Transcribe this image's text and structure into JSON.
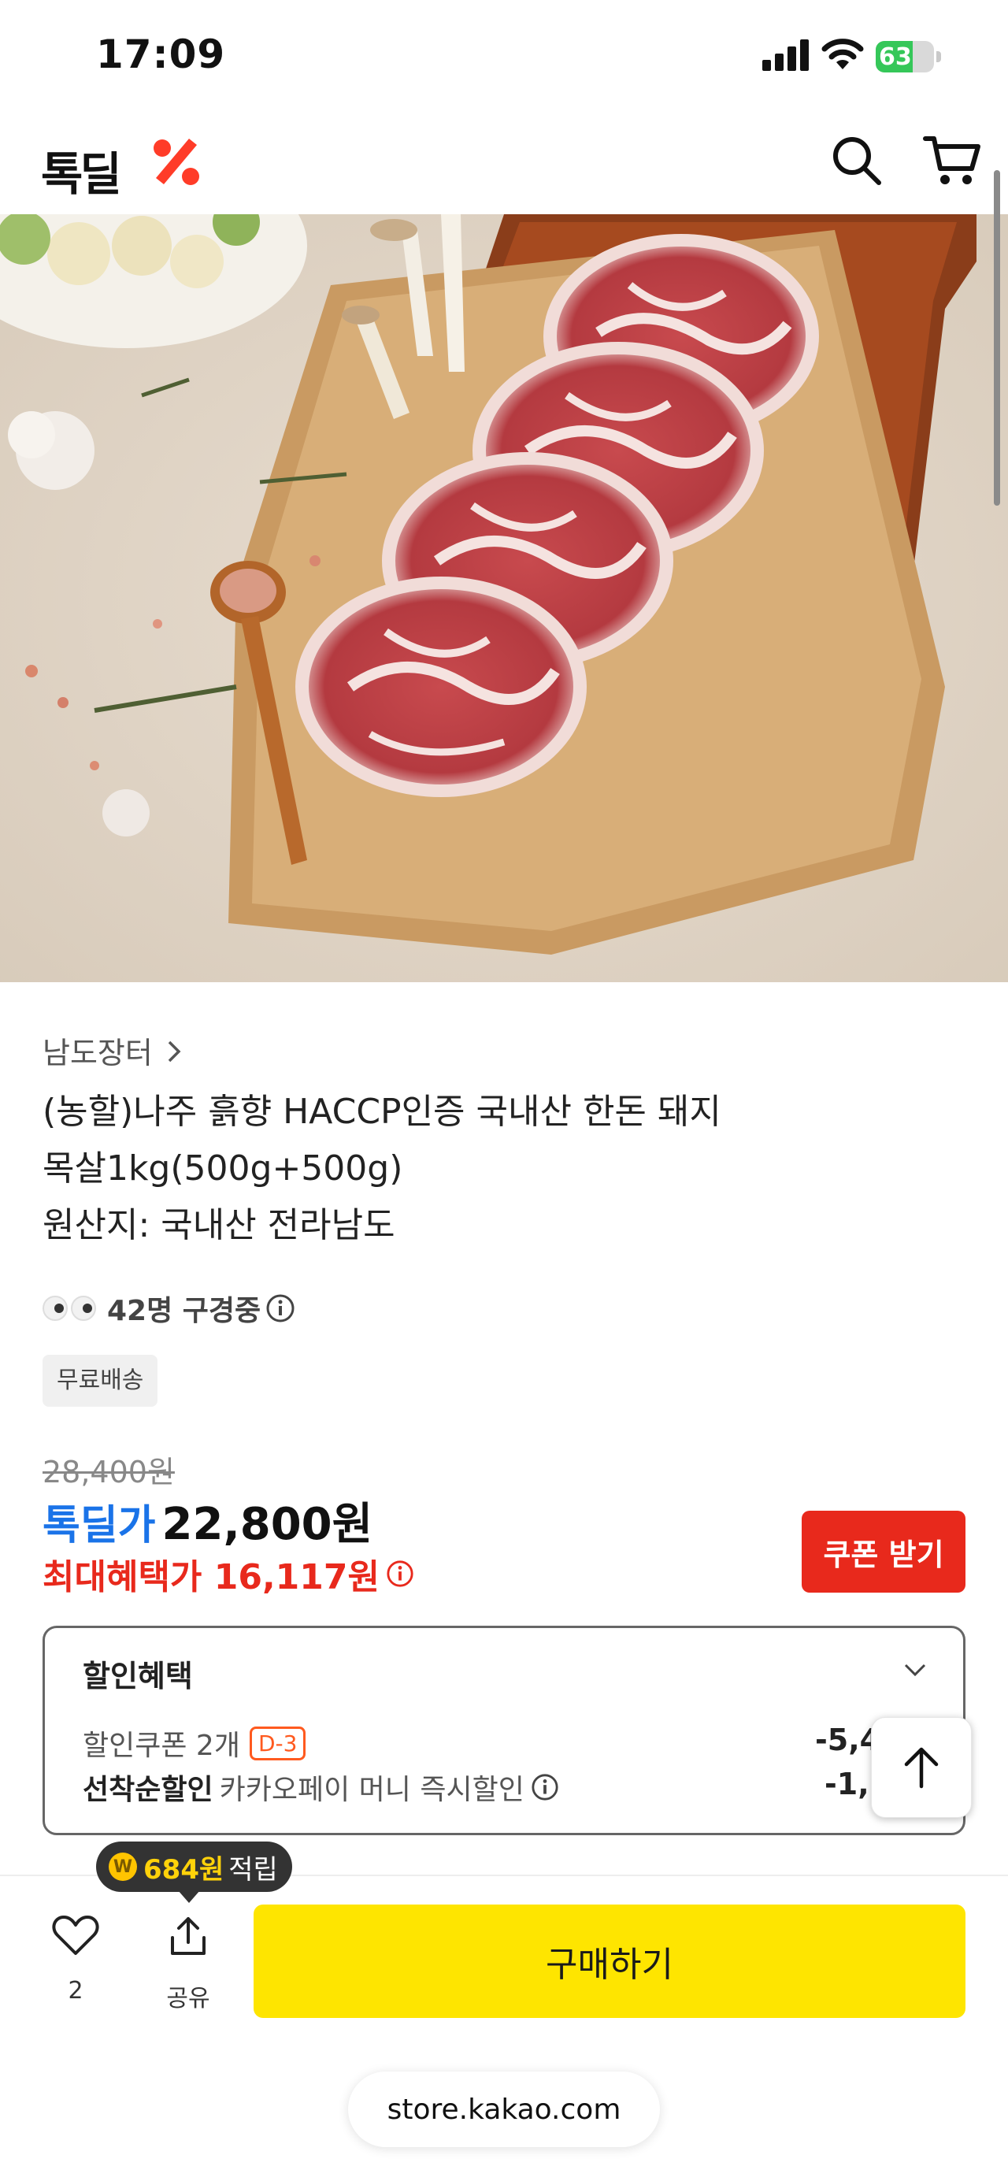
{
  "status_bar": {
    "time": "17:09",
    "battery": "63",
    "battery_level": 0.63
  },
  "header": {
    "logo": "톡딜"
  },
  "product": {
    "seller": "남도장터",
    "title_lines": [
      "(농할)나주 흙향 HACCP인증 국내산 한돈 돼지",
      "목살1kg(500g+500g)",
      "원산지: 국내산 전라남도"
    ],
    "viewers": "42명 구경중",
    "badge": "무료배송",
    "original_price": "28,400원",
    "deal_label": "톡딜가",
    "deal_price": "22,800원",
    "max_benefit": "최대혜택가 16,117원",
    "coupon_button": "쿠폰 받기"
  },
  "benefits": {
    "heading": "할인혜택",
    "coupon_text": "할인쿠폰 2개",
    "coupon_dday": "D-3",
    "coupon_value": "-5,47",
    "firstcome_label": "선착순할인",
    "firstcome_text": "카카오페이 머니 즉시할인",
    "firstcome_value": "-1,2"
  },
  "bottom_bar": {
    "points_amount": "684원",
    "points_label": "적립",
    "like_count": "2",
    "share_label": "공유",
    "buy_button": "구매하기"
  },
  "browser": {
    "url": "store.kakao.com"
  },
  "colors": {
    "accent_red": "#e8291c",
    "deal_blue": "#1a73e8",
    "buy_yellow": "#fee500"
  }
}
